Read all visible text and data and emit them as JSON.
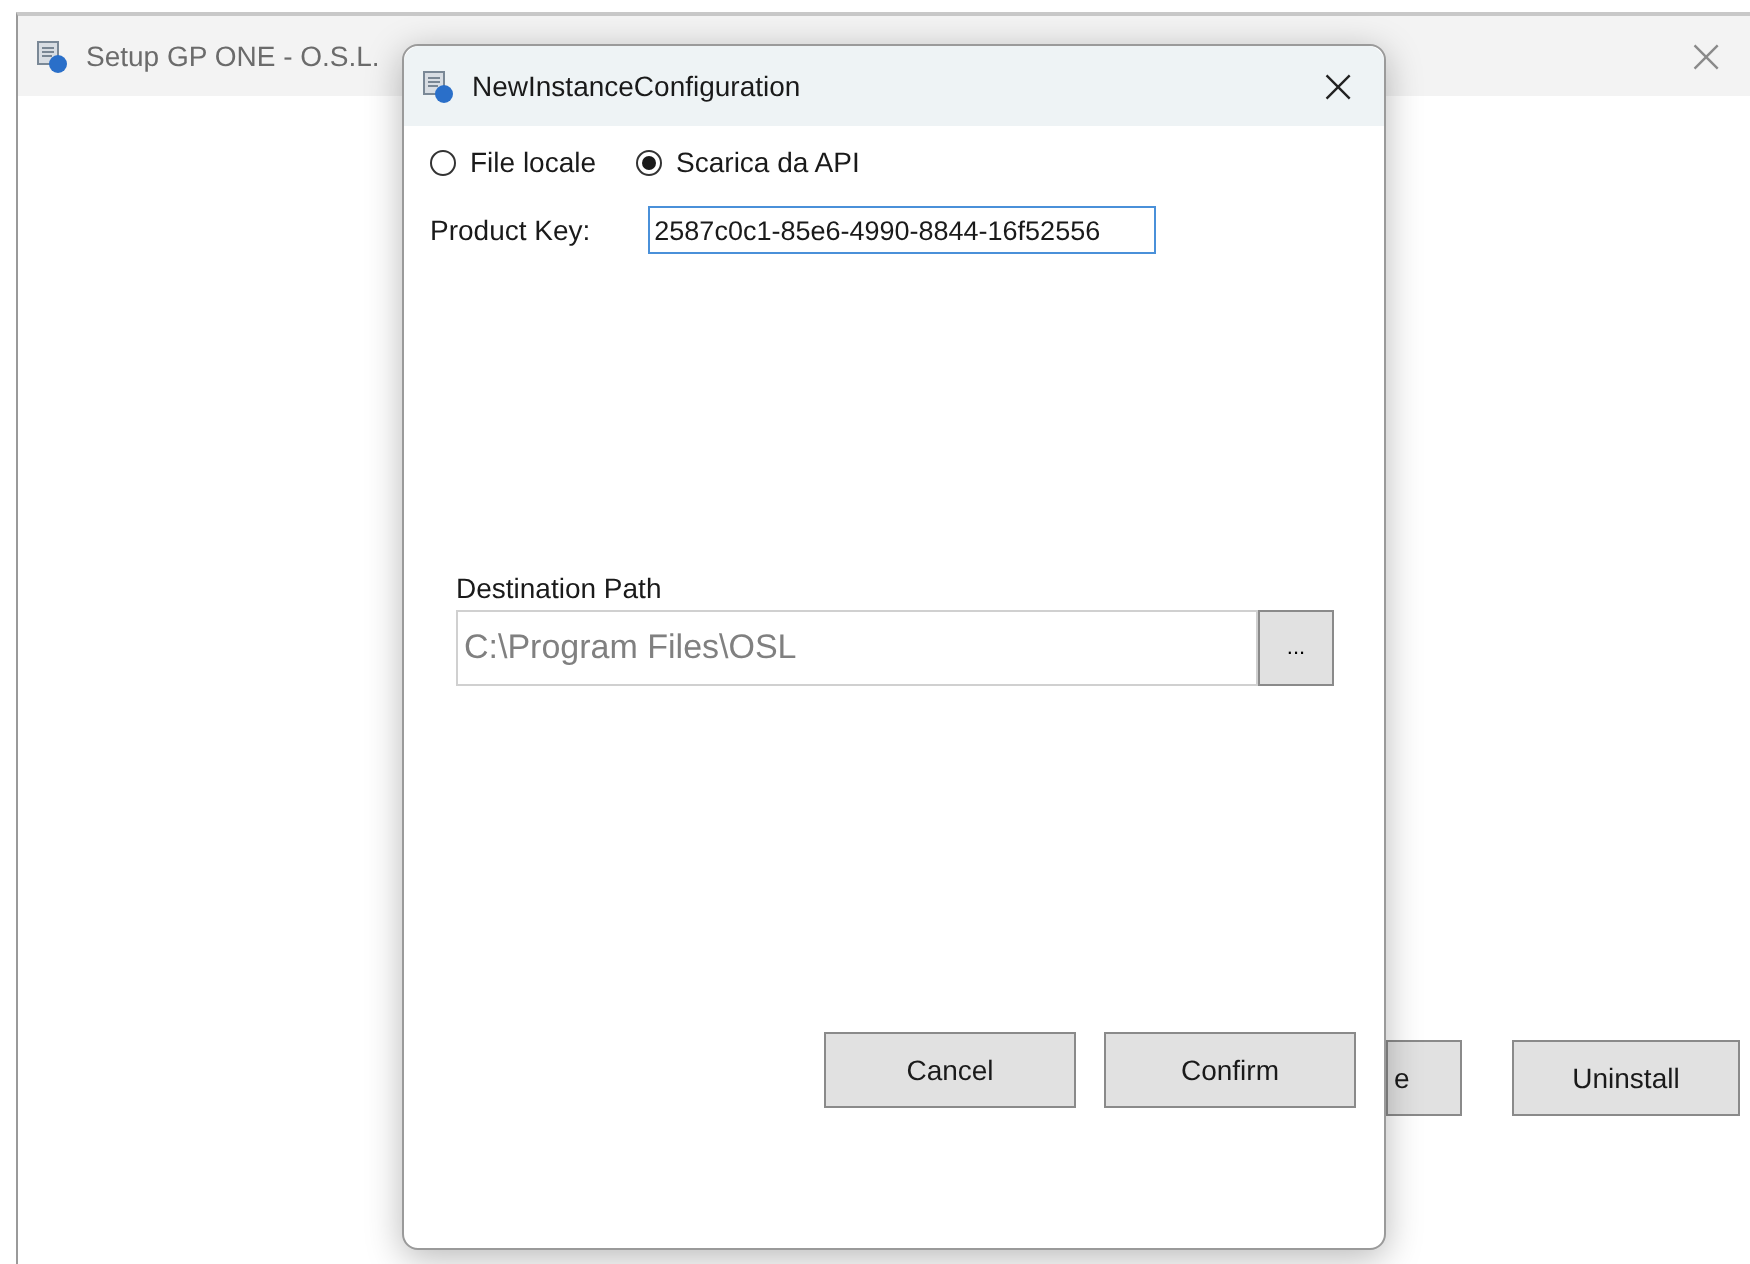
{
  "main_window": {
    "title": "Setup GP ONE - O.S.L.",
    "close": "×",
    "buttons": [
      "e",
      "Uninstall"
    ]
  },
  "dialog": {
    "title": "NewInstanceConfiguration",
    "close": "×",
    "source_options": [
      {
        "label": "File locale",
        "selected": false
      },
      {
        "label": "Scarica da API",
        "selected": true
      }
    ],
    "product_key": {
      "label": "Product Key:",
      "value": "2587c0c1-85e6-4990-8844-16f52556"
    },
    "destination": {
      "label": "Destination Path",
      "placeholder": "C:\\Program Files\\OSL",
      "browse": "..."
    },
    "buttons": [
      "Cancel",
      "Confirm"
    ]
  }
}
